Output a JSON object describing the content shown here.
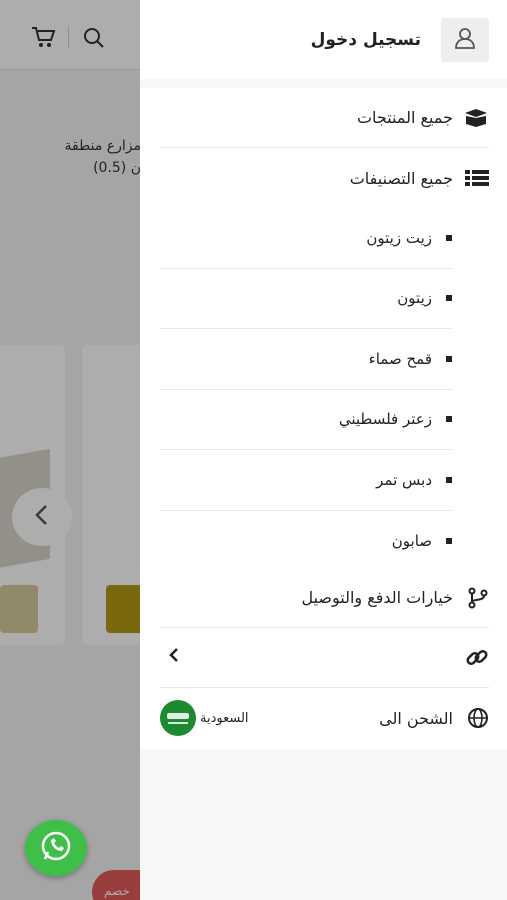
{
  "background": {
    "snippet_line1": "مزارع منطقة",
    "snippet_line2": "ن (0.5)",
    "badge_text": "خصم"
  },
  "drawer": {
    "login_label": "تسجيل دخول",
    "menu": [
      {
        "label": "جميع المنتجات",
        "icon": "box-icon"
      },
      {
        "label": "جميع التصنيفات",
        "icon": "list-icon"
      }
    ],
    "categories": [
      "زيت زيتون",
      "زيتون",
      "قمح صماء",
      "زعتر فلسطيني",
      "دبس تمر",
      "صابون"
    ],
    "payment_label": "خيارات الدفع والتوصيل",
    "shipping_label": "الشحن الى",
    "shipping_country": "السعودية"
  },
  "colors": {
    "whatsapp_green": "#3fbf4a",
    "flag_green": "#1e8a2f",
    "overlay": "rgba(0,0,0,0.32)"
  }
}
